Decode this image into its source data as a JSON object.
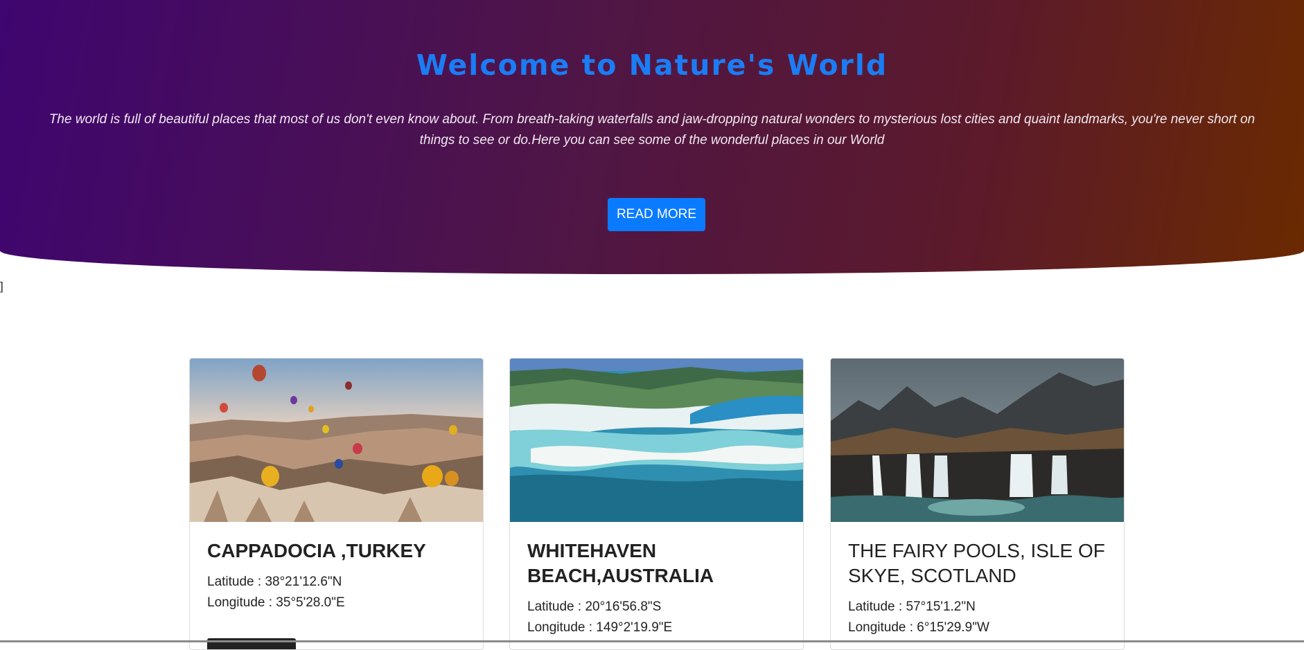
{
  "hero": {
    "title": "Welcome to Nature's World",
    "description": "The world is full of beautiful places that most of us don't even know about. From breath-taking waterfalls and jaw-dropping natural wonders to mysterious lost cities and quaint landmarks, you're never short on things to see or do.Here you can see some of the wonderful places in our World",
    "button_label": "READ MORE",
    "gradient_start": "#3f0570",
    "gradient_end": "#6a2a00",
    "title_color": "#1a7df5",
    "button_color": "#0a7bff"
  },
  "stray_text": "]",
  "cards": [
    {
      "title": "CAPPADOCIA ,TURKEY",
      "latitude": "Latitude : 38°21'12.6\"N",
      "longitude": "Longitude : 35°5'28.0\"E",
      "image": "cappadocia-balloons-photo"
    },
    {
      "title": "WHITEHAVEN BEACH,AUSTRALIA",
      "latitude": "Latitude : 20°16'56.8\"S",
      "longitude": "Longitude : 149°2'19.9\"E",
      "image": "whitehaven-beach-aerial-photo"
    },
    {
      "title": "THE FAIRY POOLS, ISLE OF SKYE, SCOTLAND",
      "latitude": "Latitude : 57°15'1.2\"N",
      "longitude": "Longitude : 6°15'29.9\"W",
      "image": "fairy-pools-waterfall-photo"
    }
  ]
}
